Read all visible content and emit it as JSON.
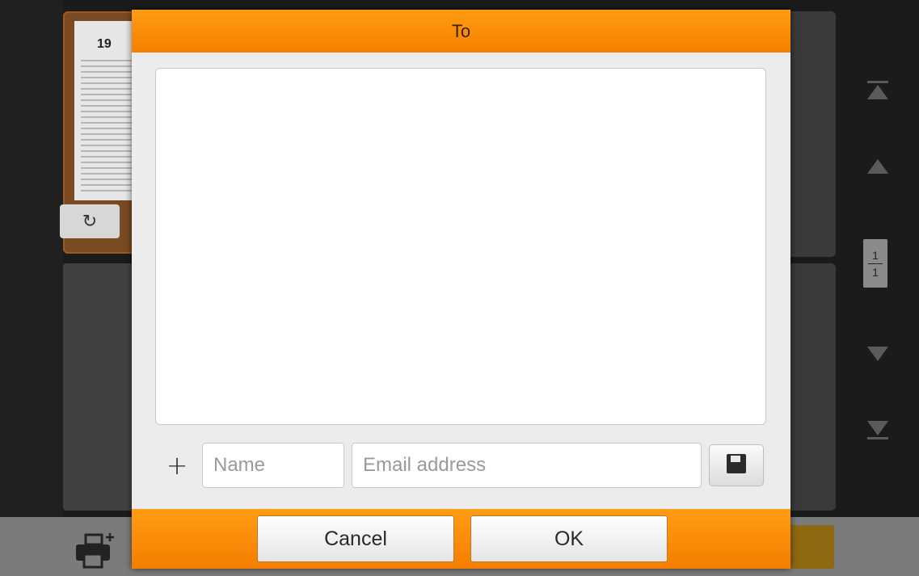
{
  "background": {
    "thumbnail": {
      "page_number": "19"
    },
    "page_indicator": {
      "current": "1",
      "total": "1"
    }
  },
  "dialog": {
    "title": "To",
    "name_placeholder": "Name",
    "email_placeholder": "Email address",
    "cancel_label": "Cancel",
    "ok_label": "OK"
  },
  "colors": {
    "accent": "#f58a08",
    "dialog_bg": "#ececec",
    "app_bg": "#1b1b1b"
  },
  "icons": [
    "rotate-icon",
    "skip-to-top-icon",
    "page-up-icon",
    "page-down-icon",
    "skip-to-bottom-icon",
    "add-printer-icon",
    "plus-icon",
    "save-disk-icon"
  ]
}
